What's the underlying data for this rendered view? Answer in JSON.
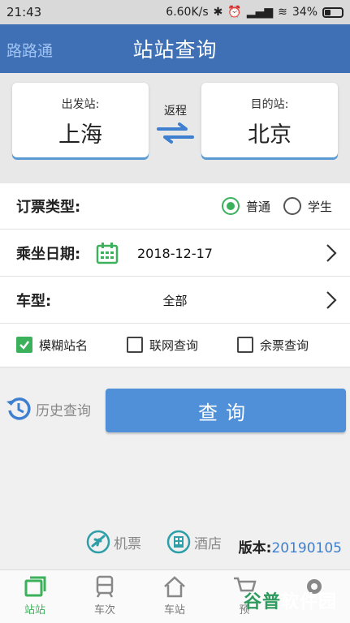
{
  "status": {
    "time": "21:43",
    "speed": "6.60K/s",
    "battery": "34%",
    "battery_level": 0.34
  },
  "app": {
    "brand": "路路通",
    "title": "站站查询"
  },
  "stations": {
    "from_label": "出发站:",
    "from_city": "上海",
    "swap_label": "返程",
    "to_label": "目的站:",
    "to_city": "北京"
  },
  "form": {
    "ticket_type_label": "订票类型:",
    "ticket_options": [
      {
        "label": "普通",
        "selected": true
      },
      {
        "label": "学生",
        "selected": false
      }
    ],
    "date_label": "乘坐日期:",
    "date_value": "2018-12-17",
    "train_type_label": "车型:",
    "train_type_value": "全部",
    "checks": [
      {
        "label": "模糊站名",
        "checked": true
      },
      {
        "label": "联网查询",
        "checked": false
      },
      {
        "label": "余票查询",
        "checked": false
      }
    ]
  },
  "actions": {
    "history_label": "历史查询",
    "query_label": "查询"
  },
  "links": {
    "flight_label": "机票",
    "hotel_label": "酒店",
    "version_label": "版本:",
    "version_value": "20190105"
  },
  "tabs": [
    {
      "label": "站站"
    },
    {
      "label": "车次"
    },
    {
      "label": "车站"
    },
    {
      "label": "预"
    },
    {
      "label": ""
    }
  ],
  "watermark": {
    "text_green": "谷普",
    "text_white": "软件园"
  },
  "colors": {
    "appbar": "#3f6fb5",
    "accent_green": "#3cb15b",
    "button_blue": "#4f90d8",
    "version_blue": "#3f7fcf"
  }
}
